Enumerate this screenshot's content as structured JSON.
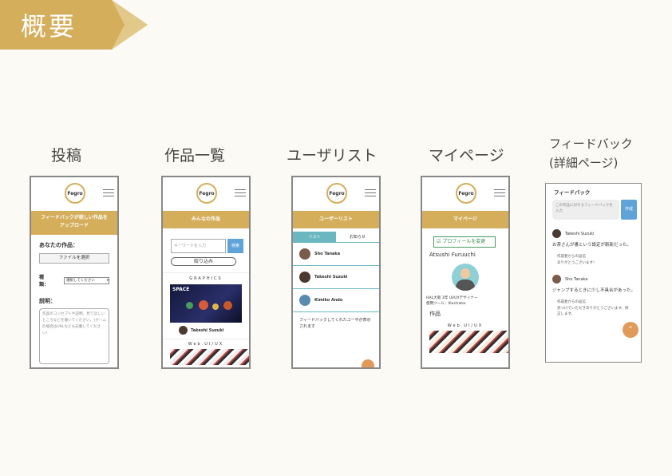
{
  "heading": "概要",
  "colors": {
    "gold": "#d4ae5a",
    "teal": "#6ab7c1",
    "blue": "#5fa3d9",
    "orange": "#e09a5a"
  },
  "screens": [
    {
      "title": "投稿"
    },
    {
      "title": "作品一覧"
    },
    {
      "title": "ユーザリスト"
    },
    {
      "title": "マイページ"
    },
    {
      "title_line1": "フィードバック",
      "title_line2": "(詳細ページ)"
    }
  ],
  "logo_text": "Fegro",
  "post": {
    "bar": "フィードバックが欲しい作品を\nアップロード",
    "work_label": "あなたの作品：",
    "file_button": "ファイルを選択",
    "type_label": "種類：",
    "type_select": "選択してください",
    "desc_label": "説明：",
    "desc_placeholder": "作品のコンセプトや説明、見てほしいところなどを書いてください。（ゲームの場合はURLなども記載してください）"
  },
  "list": {
    "bar": "みんなの作品",
    "search_placeholder": "キーワードを入力",
    "search_button": "検索",
    "filter_button": "絞り込み",
    "section1": "GRAPHICS",
    "card_title": "SPACE",
    "card_user": "Takeshi Suzuki",
    "section2": "Web.UI/UX"
  },
  "users": {
    "bar": "ユーザーリスト",
    "tab_list": "リスト",
    "tab_notice": "お知らせ",
    "items": [
      "Sho Tanaka",
      "Takeshi Suzuki",
      "Kimiko Ando"
    ],
    "footer_text": "フィードバックしてくれたユーザが表示されます"
  },
  "mypage": {
    "bar": "マイページ",
    "edit_button": "プロフィールを変更",
    "name": "Atsushi Furuuchi",
    "bio_line1": "HAL大阪 3年 UI/UXデザイナー",
    "bio_line2": "使用ツール：Illustrator",
    "works_label": "作品",
    "section": "Web.UI/UX"
  },
  "feedback": {
    "title": "フィードバック",
    "input_placeholder": "この作品に対するフィードバックを入力",
    "send_button": "作成",
    "posts": [
      {
        "user": "Takeshi Suzuki",
        "text": "お茶さんが書という設定が斬新だった。",
        "reply_label": "作成者からの返信",
        "reply": "ありがとうございます！"
      },
      {
        "user": "Sho Tanaka",
        "text": "ジャンプするときに少し不具合があった。",
        "reply_label": "作成者からの返信",
        "reply": "見つけていただきありがとうございます。修正します。"
      }
    ]
  }
}
